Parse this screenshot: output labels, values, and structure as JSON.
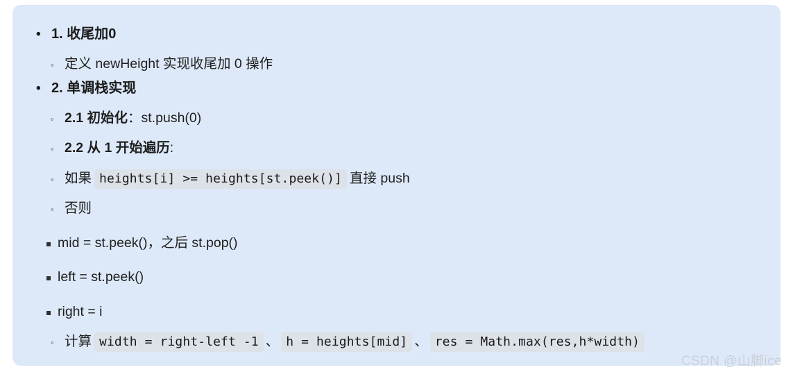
{
  "panel": {
    "background_color": "#dde9f8",
    "code_chip_color": "#dde1e8",
    "text_color": "#1b1b1b"
  },
  "outline": {
    "item1": {
      "bullet": "•",
      "title": "1. 收尾加0",
      "sub1": {
        "bullet": "◦",
        "text": "定义 newHeight 实现收尾加 0 操作"
      }
    },
    "item2": {
      "bullet": "•",
      "title": "2. 单调栈实现",
      "step21": {
        "bullet": "◦",
        "label": "2.1 初始化",
        "colon": "：",
        "value": "st.push(0)"
      },
      "step22": {
        "bullet": "◦",
        "label": "2.2 从 1 开始遍历",
        "colon": ":"
      },
      "step_if": {
        "bullet": "◦",
        "prefix": "如果",
        "code": "heights[i] >= heights[st.peek()]",
        "suffix": "直接 push"
      },
      "step_else": {
        "bullet": "◦",
        "text": "否则",
        "children": [
          {
            "bullet": "▪",
            "text": "mid = st.peek()，之后 st.pop()"
          },
          {
            "bullet": "▪",
            "text": "left = st.peek()"
          },
          {
            "bullet": "▪",
            "text": "right = i"
          }
        ]
      },
      "step_calc": {
        "bullet": "◦",
        "prefix": "计算",
        "code1": "width = right-left -1",
        "sep1": "、",
        "code2": "h = heights[mid]",
        "sep2": "、",
        "code3": "res = Math.max(res,h*width)"
      }
    }
  },
  "watermark": {
    "text": "CSDN @山脚ice"
  }
}
